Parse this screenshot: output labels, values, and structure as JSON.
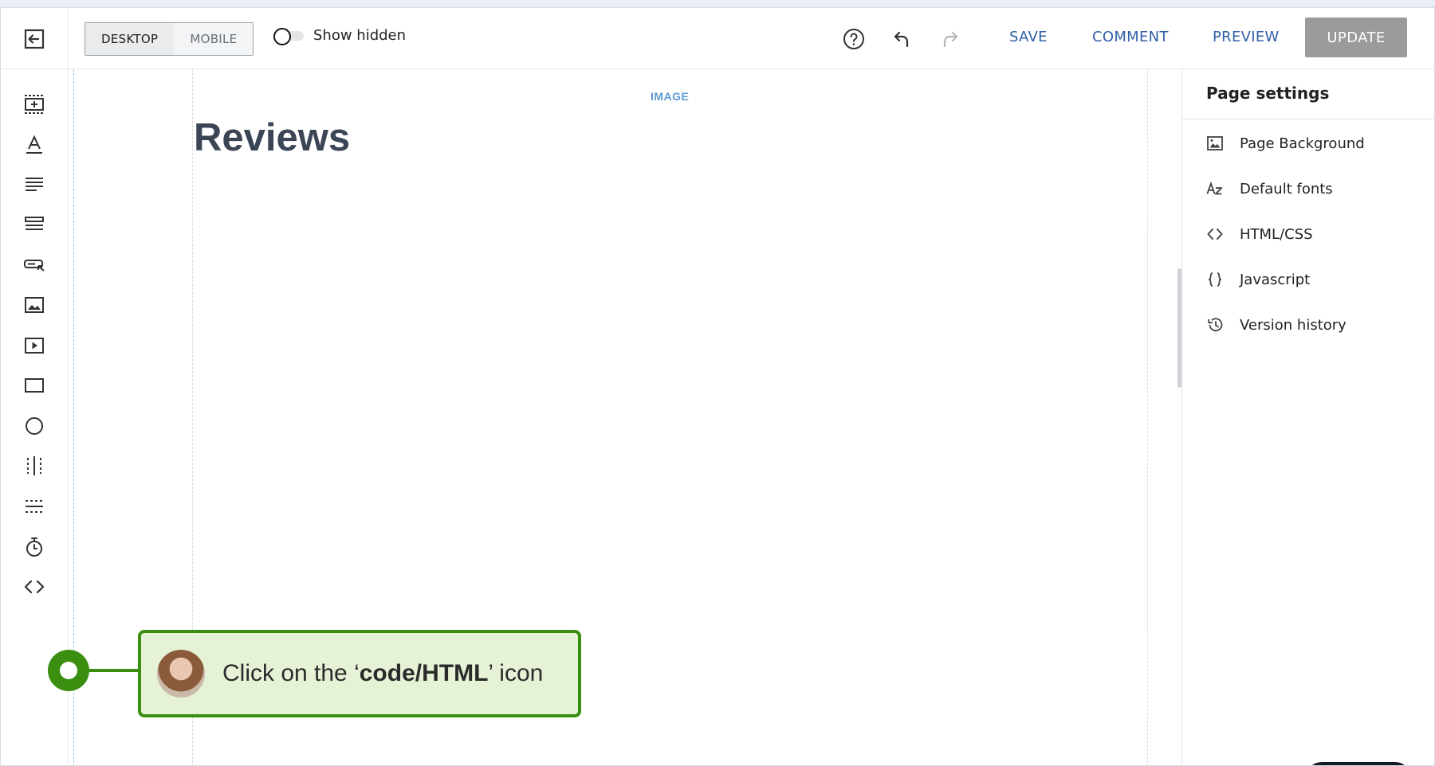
{
  "toolbar": {
    "device": {
      "desktop": "DESKTOP",
      "mobile": "MOBILE",
      "selected": "DESKTOP"
    },
    "show_hidden": {
      "label": "Show hidden",
      "on": false
    },
    "actions": {
      "save": "SAVE",
      "comment": "COMMENT",
      "preview": "PREVIEW",
      "update": "UPDATE"
    },
    "icons": [
      "exit-editor-icon",
      "help-icon",
      "undo-icon",
      "redo-icon"
    ]
  },
  "rail": {
    "tools": [
      "add-section-icon",
      "heading-text-icon",
      "paragraph-icon",
      "list-rows-icon",
      "button-icon",
      "image-icon",
      "video-icon",
      "rectangle-icon",
      "circle-icon",
      "column-divider-icon",
      "horizontal-divider-icon",
      "timer-icon",
      "code-icon"
    ]
  },
  "canvas": {
    "image_tag": "IMAGE",
    "heading": "Reviews"
  },
  "panel": {
    "title": "Page settings",
    "items": [
      {
        "label": "Page Background",
        "icon": "image-icon"
      },
      {
        "label": "Default fonts",
        "icon": "font-az-icon"
      },
      {
        "label": "HTML/CSS",
        "icon": "code-icon"
      },
      {
        "label": "Javascript",
        "icon": "braces-icon"
      },
      {
        "label": "Version history",
        "icon": "history-icon"
      }
    ]
  },
  "callout": {
    "prefix": "Click on the ‘",
    "bold": "code/HTML",
    "suffix": "’ icon"
  },
  "colors": {
    "link_blue": "#2f5fa7",
    "callout_green": "#3a8f10",
    "callout_bg": "#e6f2d6",
    "update_gray": "#9a9b9c",
    "image_tag_blue": "#5b9ad6"
  }
}
